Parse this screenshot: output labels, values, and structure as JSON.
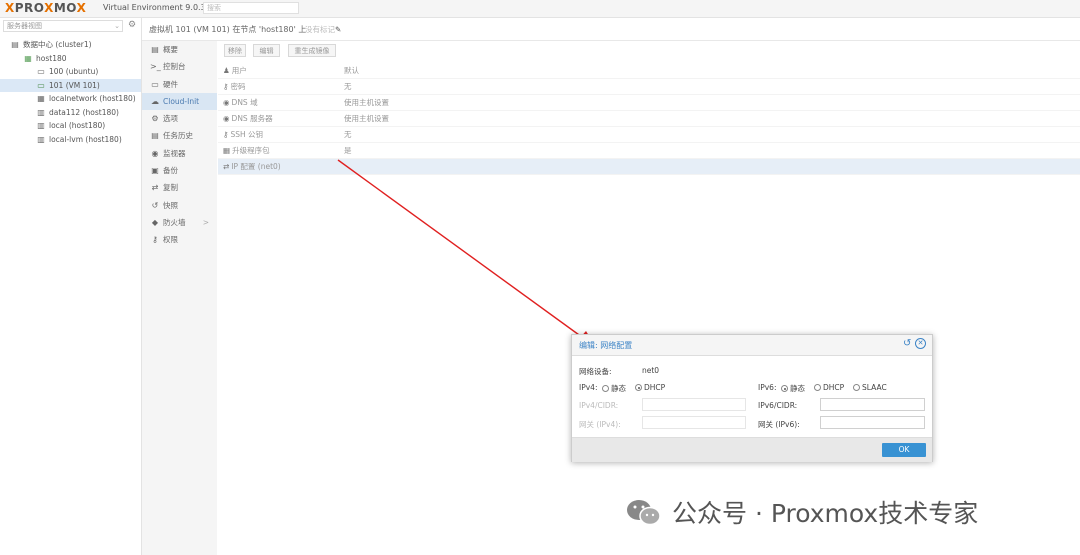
{
  "app": {
    "logo_pro": "PRO",
    "logo_x": "X",
    "logo_mo": "MO",
    "logo_x2": "X",
    "version": "Virtual Environment 9.0.3",
    "search_placeholder": "搜索"
  },
  "left": {
    "view_selector": "服务器视图",
    "tree": [
      {
        "label": "数据中心 (cluster1)",
        "icon": "datacenter-icon",
        "indent": 0
      },
      {
        "label": "host180",
        "icon": "node-icon",
        "indent": 1
      },
      {
        "label": "100 (ubuntu)",
        "icon": "vm-icon",
        "indent": 2
      },
      {
        "label": "101 (VM 101)",
        "icon": "vm-running-icon",
        "indent": 2,
        "selected": true
      },
      {
        "label": "localnetwork (host180)",
        "icon": "network-icon",
        "indent": 2
      },
      {
        "label": "data112 (host180)",
        "icon": "storage-icon",
        "indent": 2
      },
      {
        "label": "local (host180)",
        "icon": "storage-icon",
        "indent": 2
      },
      {
        "label": "local-lvm (host180)",
        "icon": "storage-icon",
        "indent": 2
      }
    ]
  },
  "header": {
    "crumb": "虚拟机 101 (VM 101) 在节点 'host180' 上",
    "note": "没有标记"
  },
  "sidenav": [
    {
      "label": "概要",
      "icon": "summary-icon"
    },
    {
      "label": "控制台",
      "icon": "console-icon"
    },
    {
      "label": "硬件",
      "icon": "hardware-icon"
    },
    {
      "label": "Cloud-Init",
      "icon": "cloud-icon",
      "selected": true
    },
    {
      "label": "选项",
      "icon": "options-icon"
    },
    {
      "label": "任务历史",
      "icon": "task-history-icon"
    },
    {
      "label": "监视器",
      "icon": "monitor-icon"
    },
    {
      "label": "备份",
      "icon": "backup-icon"
    },
    {
      "label": "复制",
      "icon": "replication-icon"
    },
    {
      "label": "快照",
      "icon": "snapshot-icon"
    },
    {
      "label": "防火墙",
      "icon": "firewall-icon",
      "chevron": ">"
    },
    {
      "label": "权限",
      "icon": "permissions-icon"
    }
  ],
  "toolbar": {
    "remove": "移除",
    "edit": "编辑",
    "regenerate": "重生成镜像"
  },
  "grid": [
    {
      "key": "用户",
      "value": "默认",
      "icon": "user-icon"
    },
    {
      "key": "密码",
      "value": "无",
      "icon": "key-icon"
    },
    {
      "key": "DNS 域",
      "value": "使用主机设置",
      "icon": "globe-icon"
    },
    {
      "key": "DNS 服务器",
      "value": "使用主机设置",
      "icon": "globe-icon"
    },
    {
      "key": "SSH 公钥",
      "value": "无",
      "icon": "ssh-key-icon"
    },
    {
      "key": "升级程序包",
      "value": "是",
      "icon": "package-icon"
    },
    {
      "key": "IP 配置 (net0)",
      "value": "",
      "icon": "exchange-icon",
      "selected": true
    }
  ],
  "dialog": {
    "title_edit": "编辑",
    "title_main": "网络配置",
    "device_label": "网络设备:",
    "device_value": "net0",
    "ipv4_label": "IPv4:",
    "ipv4_static": "静态",
    "ipv4_dhcp": "DHCP",
    "ipv4_selected": "DHCP",
    "ipv6_label": "IPv6:",
    "ipv6_static": "静态",
    "ipv6_dhcp": "DHCP",
    "ipv6_slaac": "SLAAC",
    "ipv6_selected": "静态",
    "ipv4_cidr_label": "IPv4/CIDR:",
    "ipv4_gw_label": "网关 (IPv4):",
    "ipv6_cidr_label": "IPv6/CIDR:",
    "ipv6_gw_label": "网关 (IPv6):",
    "ok": "OK"
  },
  "watermark": "公众号 · Proxmox技术专家",
  "colors": {
    "accent": "#3892d3",
    "logo_orange": "#e57000",
    "arrow": "#e02020",
    "selection": "#d9e6f3"
  }
}
